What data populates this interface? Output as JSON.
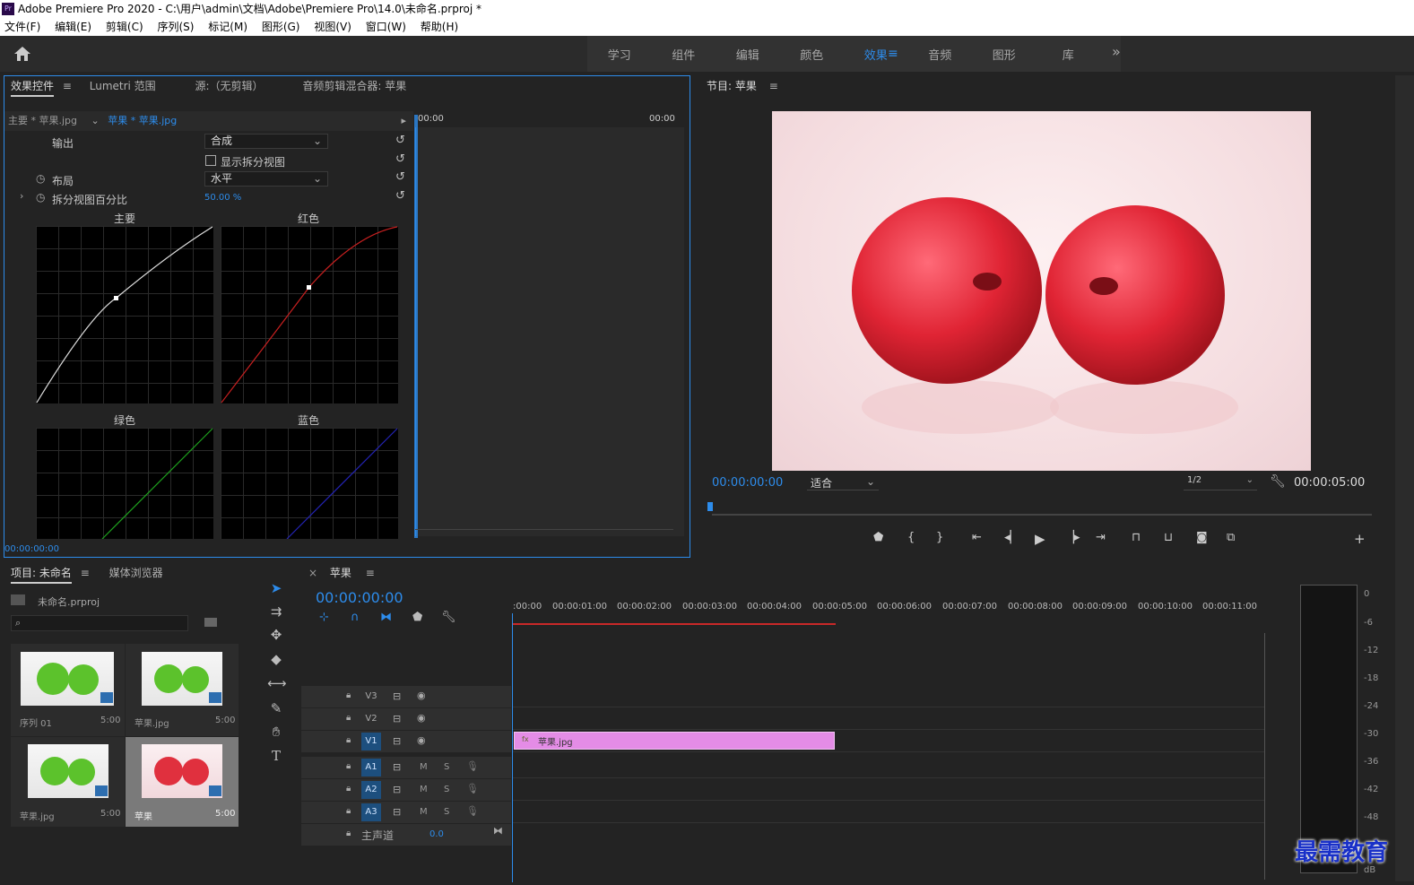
{
  "app": {
    "title": "Adobe Premiere Pro 2020 - C:\\用户\\admin\\文档\\Adobe\\Premiere Pro\\14.0\\未命名.prproj *",
    "logo": "Pr"
  },
  "menu": [
    "文件(F)",
    "编辑(E)",
    "剪辑(C)",
    "序列(S)",
    "标记(M)",
    "图形(G)",
    "视图(V)",
    "窗口(W)",
    "帮助(H)"
  ],
  "workspaces": {
    "tabs": [
      "学习",
      "组件",
      "编辑",
      "颜色",
      "效果",
      "音频",
      "图形",
      "库"
    ],
    "active": "效果",
    "more": "»"
  },
  "effect_panel": {
    "tabs": [
      "效果控件",
      "Lumetri 范围",
      "源:（无剪辑）",
      "音频剪辑混合器: 苹果"
    ],
    "clip_master": "主要 * 苹果.jpg",
    "clip_active": "苹果 * 苹果.jpg",
    "time_start": "00:00",
    "time_end": "00:00",
    "rows": [
      {
        "label": "输出",
        "value": "合成",
        "type": "select"
      },
      {
        "label": "显示拆分视图",
        "type": "checkbox"
      },
      {
        "label": "布局",
        "value": "水平",
        "type": "select"
      },
      {
        "label": "拆分视图百分比",
        "value": "50.00 %",
        "type": "number"
      }
    ],
    "curves": [
      "主要",
      "红色",
      "绿色",
      "蓝色"
    ],
    "footer_time": "00:00:00:00"
  },
  "program": {
    "title": "节目: 苹果",
    "timecode": "00:00:00:00",
    "fit": "适合",
    "resolution": "1/2",
    "duration": "00:00:05:00"
  },
  "project": {
    "tabs": [
      "项目: 未命名",
      "媒体浏览器"
    ],
    "file": "未命名.prproj",
    "items": [
      {
        "name": "序列 01",
        "dur": "5:00",
        "color": "green"
      },
      {
        "name": "苹果.jpg",
        "dur": "5:00",
        "color": "green"
      },
      {
        "name": "苹果.jpg",
        "dur": "5:00",
        "color": "green"
      },
      {
        "name": "苹果",
        "dur": "5:00",
        "color": "red"
      }
    ]
  },
  "timeline": {
    "title": "苹果",
    "timecode": "00:00:00:00",
    "ruler": [
      ":00:00",
      "00:00:01:00",
      "00:00:02:00",
      "00:00:03:00",
      "00:00:04:00",
      "00:00:05:00",
      "00:00:06:00",
      "00:00:07:00",
      "00:00:08:00",
      "00:00:09:00",
      "00:00:10:00",
      "00:00:11:00"
    ],
    "video_tracks": [
      "V3",
      "V2",
      "V1"
    ],
    "audio_tracks": [
      "A1",
      "A2",
      "A3"
    ],
    "master_label": "主声道",
    "master_value": "0.0",
    "clip": "苹果.jpg",
    "m_label": "M",
    "s_label": "S"
  },
  "meter": {
    "scale": [
      "0",
      "-6",
      "-12",
      "-18",
      "-24",
      "-30",
      "-36",
      "-42",
      "-48"
    ],
    "unit": "dB"
  },
  "watermark": "最需教育",
  "colors": {
    "accent": "#2d8ceb",
    "clip": "#e48ce6",
    "panel": "#232323"
  }
}
